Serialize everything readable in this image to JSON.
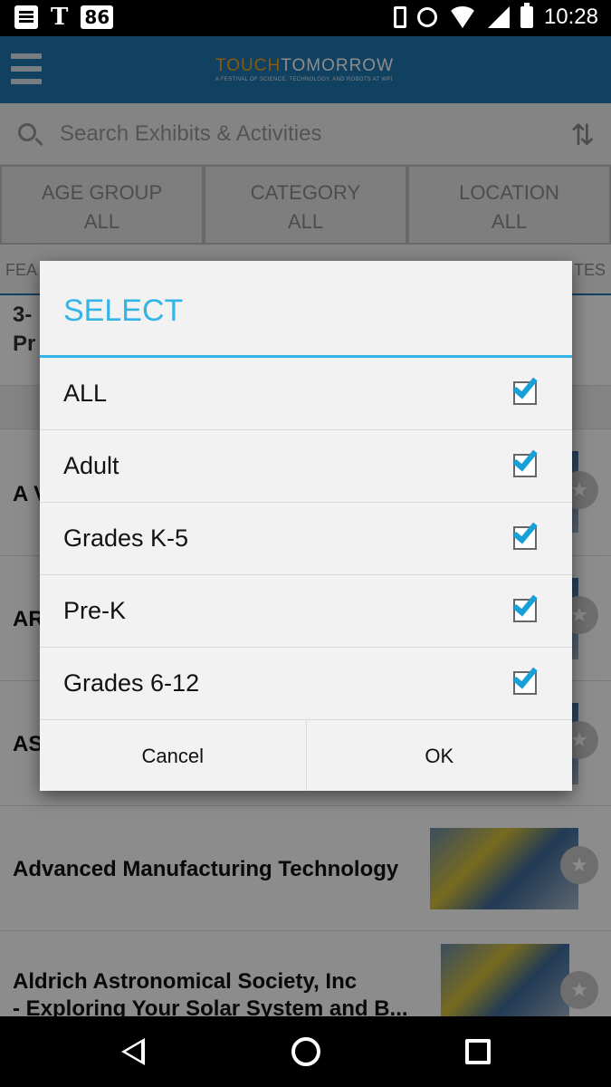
{
  "status_bar": {
    "time": "10:28",
    "badge": "86",
    "carrier": "T"
  },
  "header": {
    "logo_touch": "TOUCH",
    "logo_tomorrow": "TOMORROW",
    "logo_tagline": "A FESTIVAL OF SCIENCE, TECHNOLOGY, AND ROBOTS AT WPI",
    "menu_icon": "hamburger-icon"
  },
  "search": {
    "placeholder": "Search Exhibits & Activities",
    "sort_icon": "sort-icon"
  },
  "filters": [
    {
      "label": "AGE GROUP",
      "value": "ALL"
    },
    {
      "label": "CATEGORY",
      "value": "ALL"
    },
    {
      "label": "LOCATION",
      "value": "ALL"
    }
  ],
  "tabs": {
    "left": "FEA",
    "right": "TES"
  },
  "list": [
    {
      "title": "3-",
      "sub": "Pr"
    },
    {
      "title": "A V"
    },
    {
      "title": "AR"
    },
    {
      "title": "AS"
    },
    {
      "title": "Advanced Manufacturing Technology"
    },
    {
      "title": "Aldrich Astronomical Society, Inc",
      "sub": "- Exploring Your Solar System and B..."
    }
  ],
  "dialog": {
    "title": "SELECT",
    "options": [
      {
        "label": "ALL",
        "checked": true
      },
      {
        "label": "Adult",
        "checked": true
      },
      {
        "label": "Grades K-5",
        "checked": true
      },
      {
        "label": "Pre-K",
        "checked": true
      },
      {
        "label": "Grades 6-12",
        "checked": true
      }
    ],
    "cancel_label": "Cancel",
    "ok_label": "OK"
  },
  "colors": {
    "appbar": "#1f77b0",
    "accent": "#33b5e5",
    "logo_orange": "#f7a21b"
  }
}
